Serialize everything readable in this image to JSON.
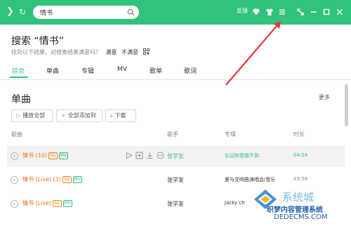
{
  "topbar": {
    "search_value": "情书",
    "feedback_label": "反馈",
    "colors": {
      "brand": "#31c27c"
    }
  },
  "header": {
    "title": "搜索 “情书”",
    "hint_text": "找到以下结果，对搜索结果满意吗？",
    "answers": [
      "满意",
      "不满意"
    ]
  },
  "tabs": [
    {
      "label": "综合",
      "active": true
    },
    {
      "label": "单曲"
    },
    {
      "label": "专辑"
    },
    {
      "label": "MV"
    },
    {
      "label": "歌单"
    },
    {
      "label": "歌词"
    }
  ],
  "section": {
    "title": "单曲",
    "more_label": "更多",
    "buttons": [
      {
        "icon": "play-icon",
        "label": "播放全部"
      },
      {
        "icon": "plus-icon",
        "label": "全部添加到"
      },
      {
        "icon": "download-icon",
        "label": "下载"
      }
    ],
    "columns": [
      "歌曲",
      "歌手",
      "专辑",
      "时长"
    ]
  },
  "rows": [
    {
      "title": "情书 (10)",
      "badges": [
        "SQ",
        "MV"
      ],
      "artist": "张学友",
      "album": "忘记你我做不到",
      "duration": "04:04",
      "highlight": true
    },
    {
      "title": "情书 (Live) (3)",
      "badges": [
        "SQ",
        "MV"
      ],
      "artist": "张学友",
      "album": "爱与交响曲演唱会/音乐",
      "duration": "03:58"
    },
    {
      "title": "情书 (Live)",
      "badges": [
        "SQ",
        "MV"
      ],
      "artist": "张学友",
      "album": "Jacky ch",
      "duration": ""
    }
  ],
  "watermark": {
    "brand": "系统城",
    "line1": "织梦内容管理系统",
    "line2": "DEDECMS.COM"
  }
}
